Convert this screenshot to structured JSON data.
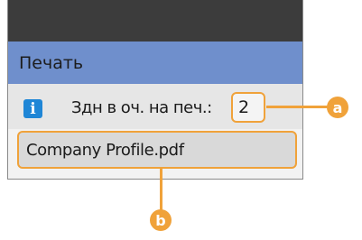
{
  "screen": {
    "title": "Печать",
    "info_label": "Здн в оч. на печ.:",
    "job_count": "2",
    "file_name": "Company Profile.pdf"
  },
  "icons": {
    "info": "info-icon",
    "info_glyph": "i"
  },
  "callouts": {
    "a": "a",
    "b": "b"
  },
  "colors": {
    "topbar": "#3c3c3c",
    "titlebar": "#6f8fcc",
    "accent": "#f0a23a",
    "info_icon": "#1f86d6"
  }
}
